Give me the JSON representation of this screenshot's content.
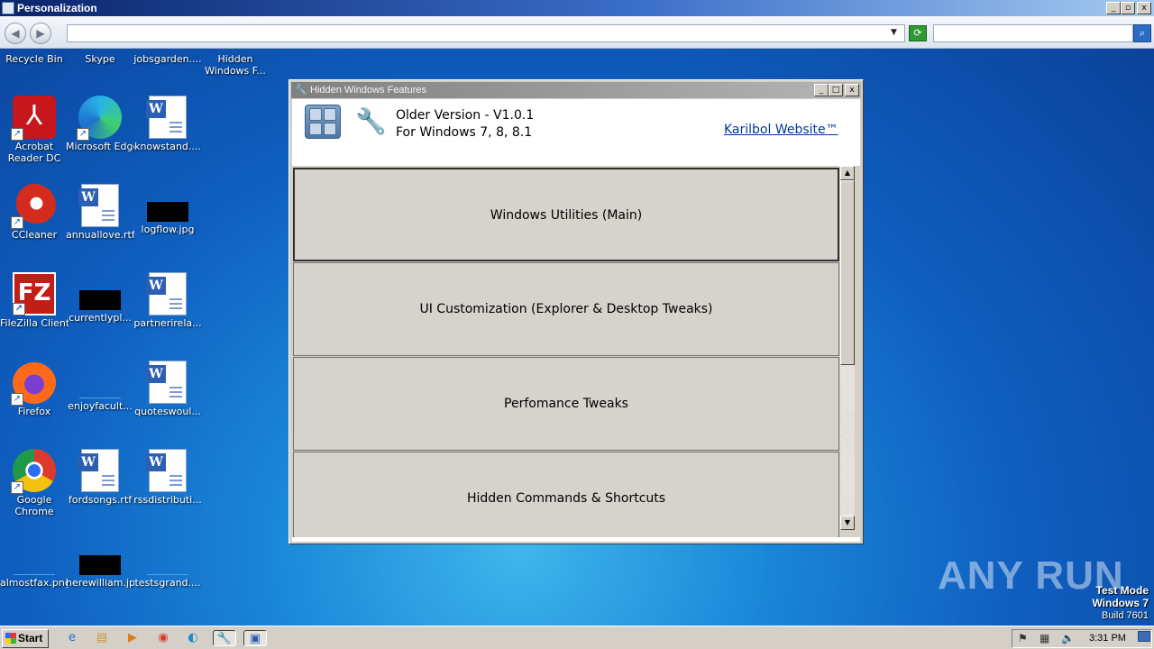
{
  "explorer": {
    "title": "Personalization",
    "address_value": "",
    "search_value": "",
    "caption_buttons": [
      "_",
      "▫",
      "x"
    ]
  },
  "desktop": {
    "icons": [
      {
        "label": "Recycle Bin"
      },
      {
        "label": "Skype"
      },
      {
        "label": "jobsgarden...."
      },
      {
        "label": "Hidden Windows F..."
      },
      {
        "label": "Acrobat Reader DC"
      },
      {
        "label": "Microsoft Edge"
      },
      {
        "label": "knowstand...."
      },
      {
        "label": "CCleaner"
      },
      {
        "label": "annuallove.rtf"
      },
      {
        "label": "logflow.jpg"
      },
      {
        "label": "FileZilla Client"
      },
      {
        "label": "currentlypl..."
      },
      {
        "label": "partnerirela..."
      },
      {
        "label": "Firefox"
      },
      {
        "label": "enjoyfacult..."
      },
      {
        "label": "quoteswoul..."
      },
      {
        "label": "Google Chrome"
      },
      {
        "label": "fordsongs.rtf"
      },
      {
        "label": "rssdistributi..."
      },
      {
        "label": "almostfax.png"
      },
      {
        "label": "herewilliam.jpg"
      },
      {
        "label": "testsgrand...."
      }
    ],
    "watermark": "ANY RUN",
    "test_mode": {
      "line1": "Test Mode",
      "line2": "Windows 7",
      "line3": "Build 7601"
    }
  },
  "app": {
    "title": "Hidden Windows Features",
    "version_line1": "Older Version - V1.0.1",
    "version_line2": "For Windows 7, 8, 8.1",
    "website_link": "Karilbol Website™",
    "menu_buttons": [
      {
        "label": "Windows Utilities (Main)"
      },
      {
        "label": "UI Customization (Explorer & Desktop Tweaks)"
      },
      {
        "label": "Perfomance Tweaks"
      },
      {
        "label": "Hidden Commands & Shortcuts"
      }
    ],
    "scrollbar_position": 0.0
  },
  "taskbar": {
    "start_label": "Start",
    "clock": "3:31 PM",
    "pinned_icons": [
      "ie-icon",
      "explorer-icon",
      "media-player-icon",
      "chrome-icon",
      "edge-icon",
      "hidden-features-icon",
      "remote-icon"
    ]
  }
}
